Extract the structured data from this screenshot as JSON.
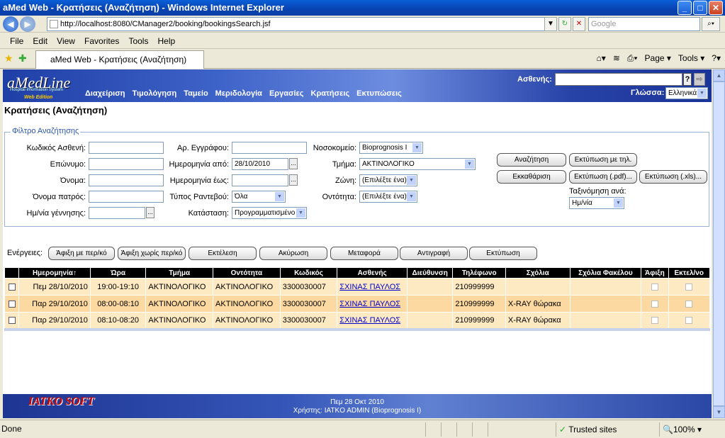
{
  "window": {
    "title": "aMed Web - Κρατήσεις (Αναζήτηση) - Windows Internet Explorer",
    "min": "_",
    "max": "□",
    "close": "✕"
  },
  "browser": {
    "url": "http://localhost:8080/CManager2/booking/bookingsSearch.jsf",
    "search_placeholder": "Google",
    "tab_title": "aMed Web - Κρατήσεις (Αναζήτηση)",
    "page_menu": "Page ▾",
    "tools_menu": "Tools ▾"
  },
  "menu": {
    "file": "File",
    "edit": "Edit",
    "view": "View",
    "favorites": "Favorites",
    "tools": "Tools",
    "help": "Help"
  },
  "app": {
    "logo": "aMedLine",
    "logo_sub": "Hospital Information System",
    "logo_edition": "Web Edition",
    "nav": [
      "Διαχείριση",
      "Τιμολόγηση",
      "Ταμείο",
      "Μεριδολογία",
      "Εργασίες",
      "Κρατήσεις",
      "Εκτυπώσεις"
    ],
    "patient_label": "Ασθενής:",
    "lang_label": "Γλώσσα:",
    "lang_value": "Ελληνικά",
    "page_title": "Κρατήσεις (Αναζήτηση)"
  },
  "filter": {
    "legend": "Φίλτρο Αναζήτησης",
    "patient_code": "Κωδικός Ασθενή:",
    "surname": "Επώνυμο:",
    "name": "Όνομα:",
    "father": "Όνομα πατρός:",
    "birth": "Ημ/νία γέννησης:",
    "doc_no": "Αρ. Εγγράφου:",
    "date_from": "Ημερομηνία από:",
    "date_from_value": "28/10/2010",
    "date_to": "Ημερομηνία έως:",
    "appt_type": "Τύπος Ραντεβού:",
    "appt_type_value": "Όλα",
    "status": "Κατάσταση:",
    "status_value": "Προγραμματισμένο",
    "hospital": "Νοσοκομείο:",
    "hospital_value": "Bioprognosis I",
    "dept": "Τμήμα:",
    "dept_value": "ΑΚΤΙΝΟΛΟΓΙΚΟ",
    "zone": "Ζώνη:",
    "zone_value": "(Επιλέξτε ένα)",
    "entity": "Οντότητα:",
    "entity_value": "(Επιλέξτε ένα)",
    "sort_label": "Ταξινόμηση ανά:",
    "sort_value": "Ημ/νία"
  },
  "buttons": {
    "search": "Αναζήτηση",
    "print_phone": "Εκτύπωση με τηλ.",
    "clear": "Εκκαθάριση",
    "print_pdf": "Εκτύπωση (.pdf)...",
    "print_xls": "Εκτύπωση (.xls)..."
  },
  "actions": {
    "label": "Ενέργειες:",
    "items": [
      "Άφιξη με περ/κό",
      "Άφιξη χωρίς περ/κό",
      "Εκτέλεση",
      "Ακύρωση",
      "Μεταφορά",
      "Αντιγραφή",
      "Εκτύπωση"
    ]
  },
  "table": {
    "headers": [
      "",
      "Ημερομηνία↑",
      "Ώρα",
      "Τμήμα",
      "Οντότητα",
      "Κωδικός",
      "Ασθενής",
      "Διεύθυνση",
      "Τηλέφωνο",
      "Σχόλια",
      "Σχόλια Φακέλου",
      "Άφιξη",
      "Εκτελ/νο"
    ],
    "rows": [
      {
        "date": "Πεμ 28/10/2010",
        "time": "19:00-19:10",
        "dept": "ΑΚΤΙΝΟΛΟΓΙΚΟ",
        "entity": "ΑΚΤΙΝΟΛΟΓΙΚΟ",
        "code": "3300030007",
        "patient": "ΣΧΙΝΑΣ ΠΑΥΛΟΣ",
        "address": "",
        "phone": "210999999",
        "comments": "",
        "folder": ""
      },
      {
        "date": "Παρ 29/10/2010",
        "time": "08:00-08:10",
        "dept": "ΑΚΤΙΝΟΛΟΓΙΚΟ",
        "entity": "ΑΚΤΙΝΟΛΟΓΙΚΟ",
        "code": "3300030007",
        "patient": "ΣΧΙΝΑΣ ΠΑΥΛΟΣ",
        "address": "",
        "phone": "210999999",
        "comments": "X-RAY θώρακα",
        "folder": ""
      },
      {
        "date": "Παρ 29/10/2010",
        "time": "08:10-08:20",
        "dept": "ΑΚΤΙΝΟΛΟΓΙΚΟ",
        "entity": "ΑΚΤΙΝΟΛΟΓΙΚΟ",
        "code": "3300030007",
        "patient": "ΣΧΙΝΑΣ ΠΑΥΛΟΣ",
        "address": "",
        "phone": "210999999",
        "comments": "X-RAY θώρακα",
        "folder": ""
      }
    ]
  },
  "footer": {
    "logo": "IATKO SOFT",
    "date": "Πεμ 28 Οκτ 2010",
    "user": "Χρήστης: IATKO ADMIN (Bioprognosis I)"
  },
  "status": {
    "left": "Done",
    "zone": "Trusted sites",
    "zoom": "100%"
  }
}
